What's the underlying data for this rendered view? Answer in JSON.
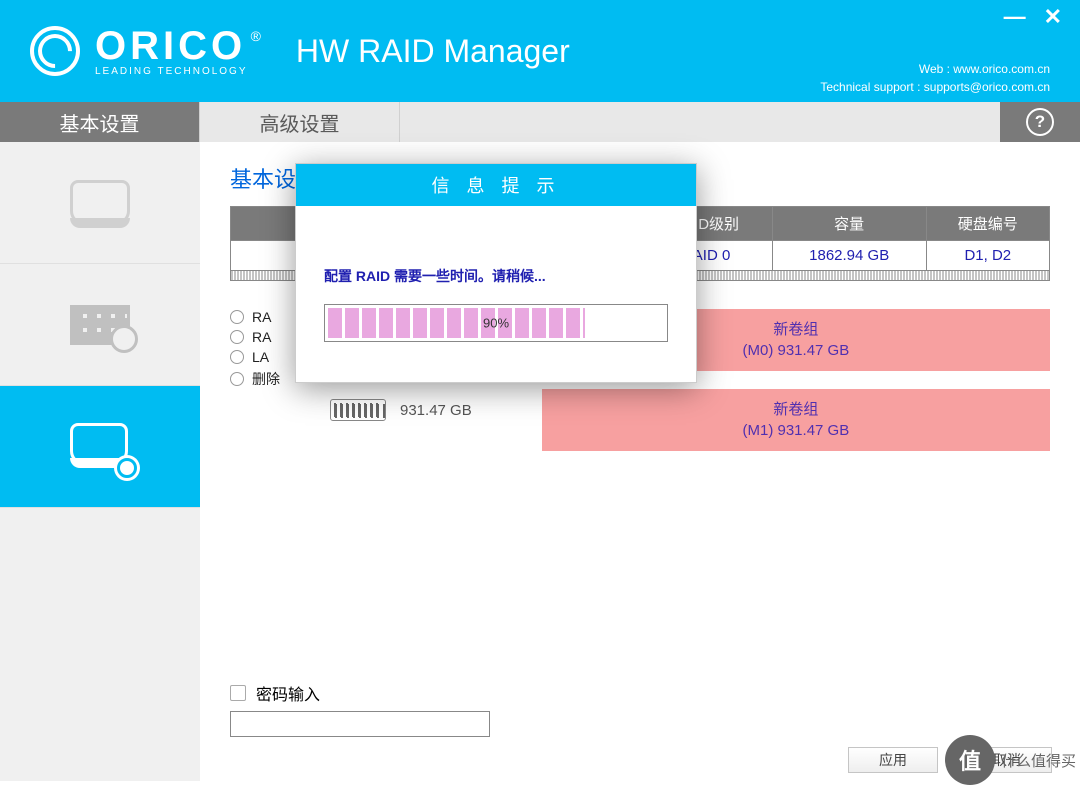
{
  "brand": {
    "name": "ORICO",
    "tagline": "LEADING TECHNOLOGY"
  },
  "app_title": "HW RAID Manager",
  "header_links": {
    "web_label": "Web :",
    "web_url": "www.orico.com.cn",
    "support_label": "Technical support :",
    "support_email": "supports@orico.com.cn"
  },
  "tabs": {
    "basic": "基本设置",
    "advanced": "高级设置"
  },
  "section_title": "基本设置",
  "table": {
    "headers": {
      "raid_level": "RAID级别",
      "capacity": "容量",
      "disk_id": "硬盘编号"
    },
    "row": {
      "raid_level": "RAID 0",
      "capacity": "1862.94 GB",
      "disk_id": "D1, D2"
    }
  },
  "radio_options": {
    "r0": "RA",
    "r1": "RA",
    "r2": "LA",
    "r3": "删除"
  },
  "drive": {
    "size": "931.47 GB"
  },
  "volumes": {
    "v0": {
      "name": "新卷组",
      "label": "(M0) 931.47 GB"
    },
    "v1": {
      "name": "新卷组",
      "label": "(M1) 931.47 GB"
    }
  },
  "password": {
    "label": "密码输入"
  },
  "buttons": {
    "apply": "应用",
    "cancel": "取消"
  },
  "modal": {
    "title": "信 息 提 示",
    "message": "配置 RAID 需要一些时间。请稍候...",
    "progress_percent": 90,
    "progress_text": "90%"
  },
  "watermark": {
    "badge": "值",
    "text": "什么值得买"
  }
}
